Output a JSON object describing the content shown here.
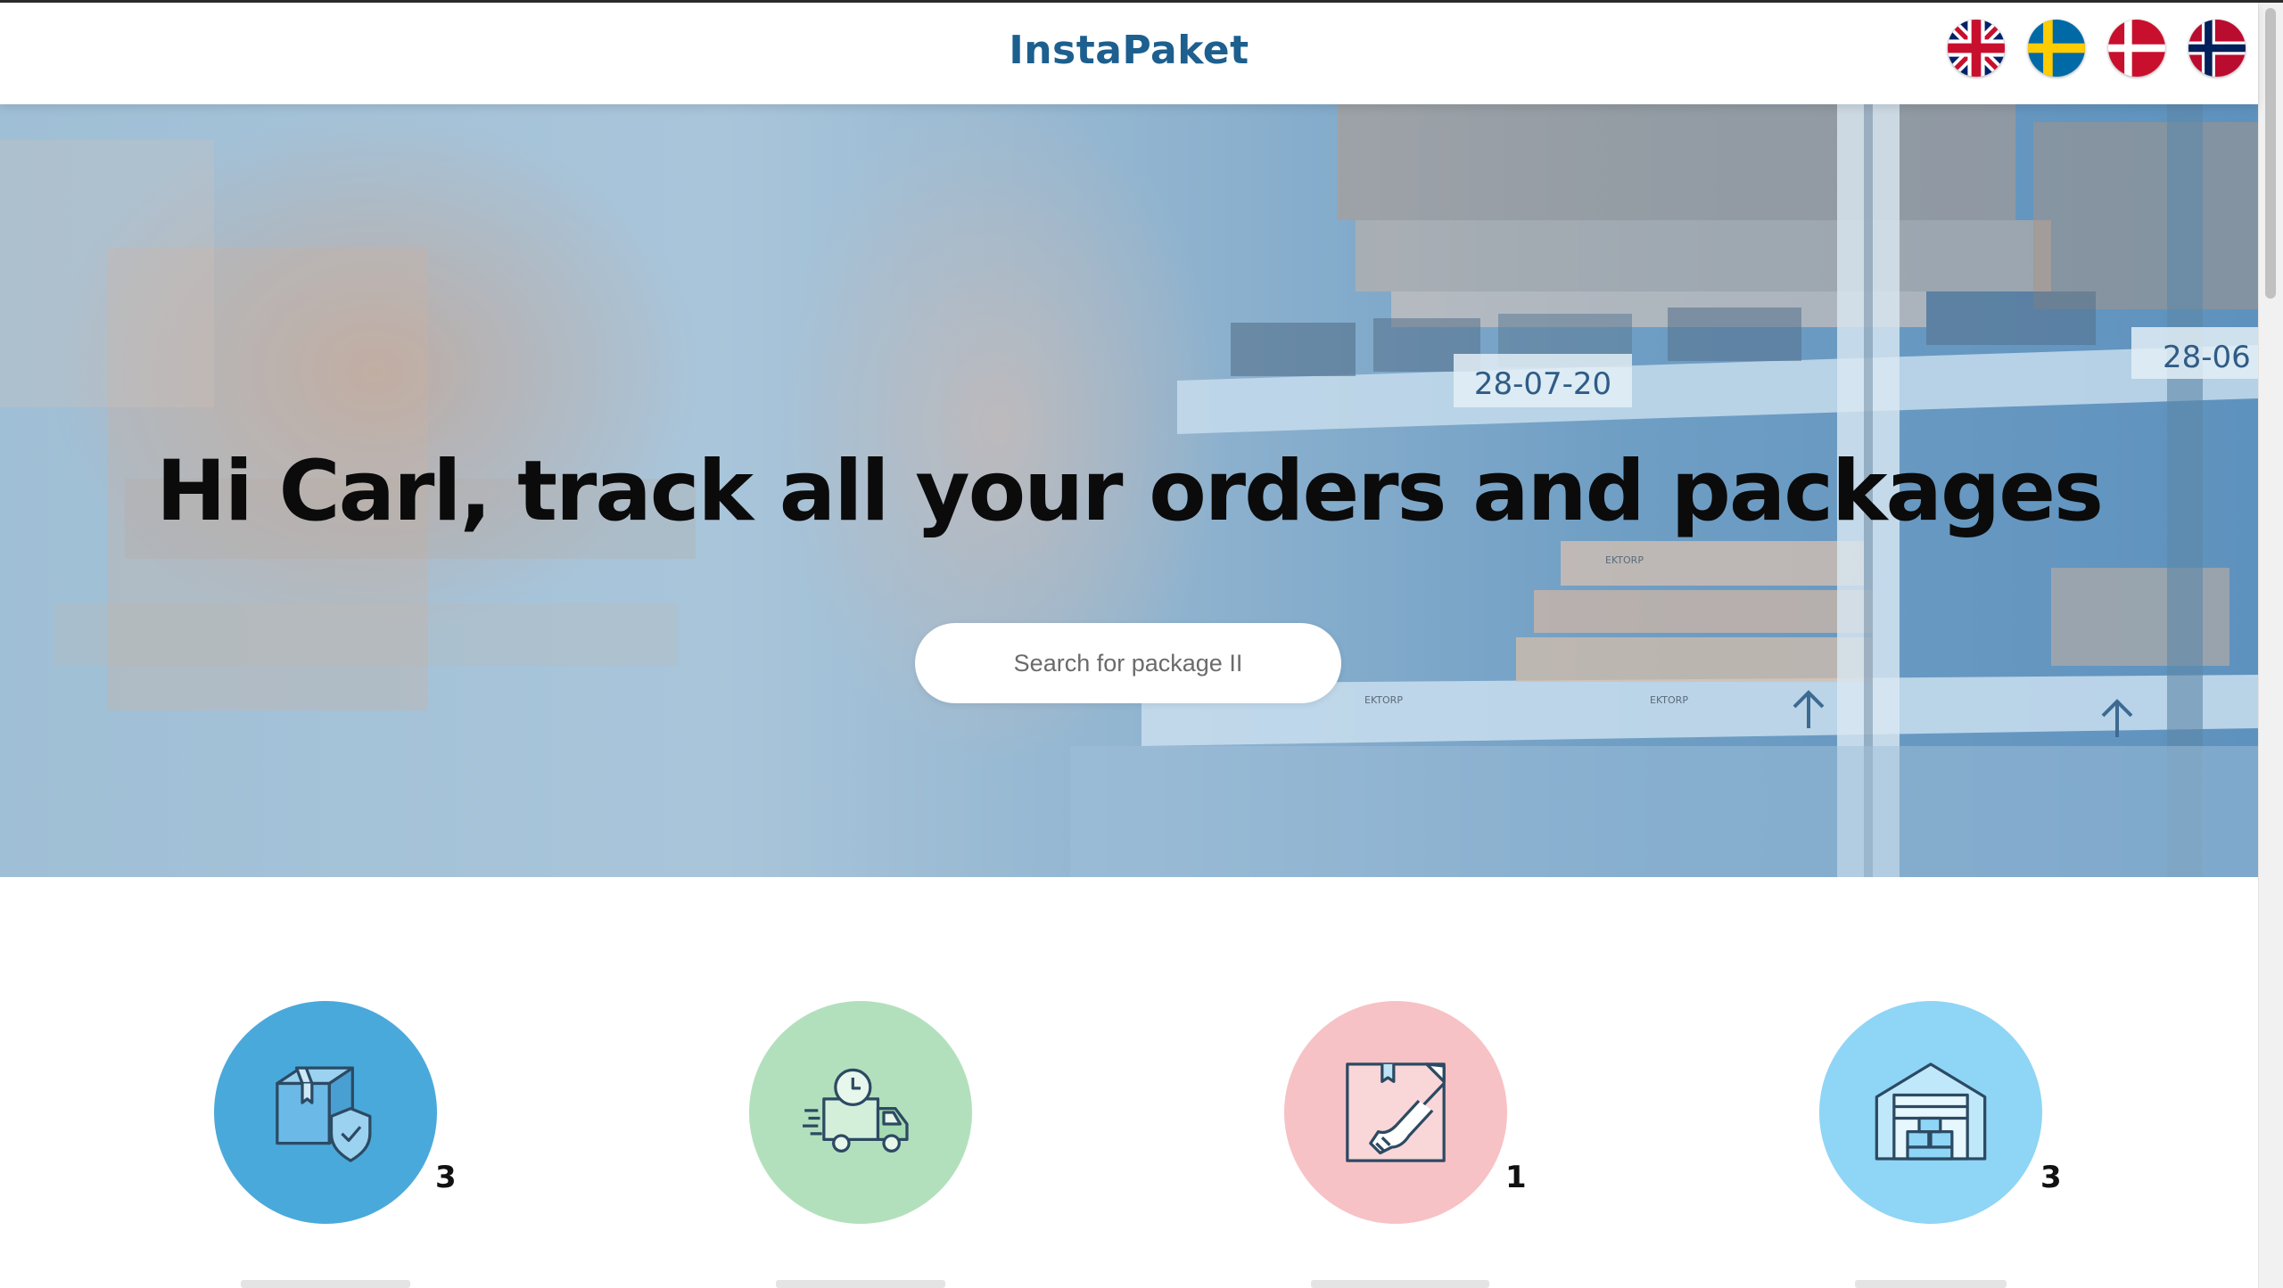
{
  "header": {
    "brand": "InstaPaket",
    "languages": [
      {
        "name": "English",
        "icon": "uk-flag-icon"
      },
      {
        "name": "Svenska",
        "icon": "sweden-flag-icon"
      },
      {
        "name": "Dansk",
        "icon": "denmark-flag-icon"
      },
      {
        "name": "Norsk",
        "icon": "norway-flag-icon"
      }
    ]
  },
  "hero": {
    "title": "Hi Carl, track all your orders and packages",
    "search_placeholder": "Search for package II",
    "shelf_labels": [
      "28-07-20",
      "28-06"
    ],
    "box_labels": [
      "EKTORP",
      "EKTORP",
      "EKTORP"
    ]
  },
  "categories": [
    {
      "icon": "insured-package-icon",
      "count": "3",
      "color": "#4aa9db"
    },
    {
      "icon": "delivery-truck-clock-icon",
      "count": "",
      "color": "#b3e0bc"
    },
    {
      "icon": "hand-package-delivered-icon",
      "count": "1",
      "color": "#f7c2c5"
    },
    {
      "icon": "warehouse-icon",
      "count": "3",
      "color": "#8fd5f5"
    }
  ]
}
